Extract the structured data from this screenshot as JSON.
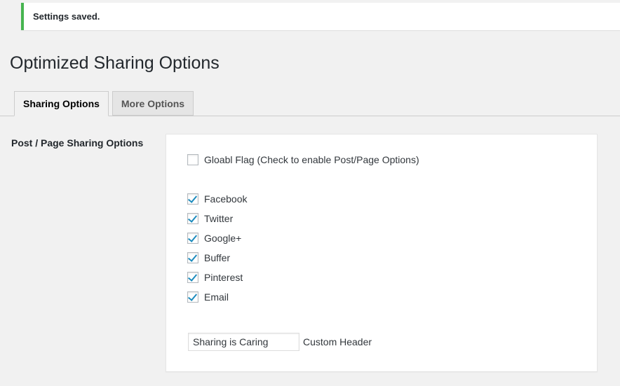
{
  "notice": {
    "text": "Settings saved."
  },
  "page": {
    "title": "Optimized Sharing Options"
  },
  "tabs": [
    {
      "label": "Sharing Options",
      "active": true
    },
    {
      "label": "More Options",
      "active": false
    }
  ],
  "section": {
    "label": "Post / Page Sharing Options",
    "global_flag": {
      "label": "Gloabl Flag (Check to enable Post/Page Options)",
      "checked": false
    },
    "networks": [
      {
        "label": "Facebook",
        "checked": true
      },
      {
        "label": "Twitter",
        "checked": true
      },
      {
        "label": "Google+",
        "checked": true
      },
      {
        "label": "Buffer",
        "checked": true
      },
      {
        "label": "Pinterest",
        "checked": true
      },
      {
        "label": "Email",
        "checked": true
      }
    ],
    "custom_header": {
      "value": "Sharing is Caring",
      "label": "Custom Header"
    }
  },
  "colors": {
    "notice_success": "#46b450",
    "checkmark": "#1e8cbe",
    "background": "#f1f1f1"
  }
}
